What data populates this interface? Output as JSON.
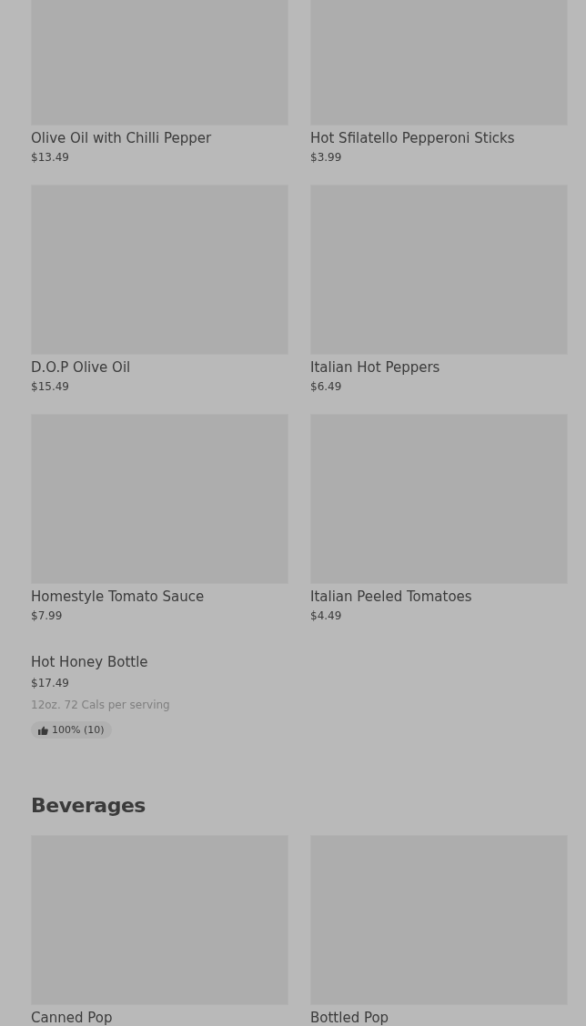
{
  "sections": [
    {
      "items": [
        {
          "kind": "image",
          "name": "Olive Oil with Chilli Pepper",
          "price": "$13.49"
        },
        {
          "kind": "image",
          "name": "Hot Sfilatello Pepperoni Sticks",
          "price": "$3.99"
        },
        {
          "kind": "image",
          "name": "D.O.P Olive Oil",
          "price": "$15.49"
        },
        {
          "kind": "image",
          "name": "Italian Hot Peppers",
          "price": "$6.49"
        },
        {
          "kind": "image",
          "name": "Homestyle Tomato Sauce",
          "price": "$7.99"
        },
        {
          "kind": "image",
          "name": "Italian Peeled Tomatoes",
          "price": "$4.49"
        },
        {
          "kind": "plain",
          "name": "Hot Honey Bottle",
          "price": "$17.49",
          "details": "12oz. 72 Cals per serving",
          "rating": "100% (10)"
        }
      ]
    },
    {
      "heading": "Beverages",
      "items": [
        {
          "kind": "image",
          "name": "Canned Pop"
        },
        {
          "kind": "image",
          "name": "Bottled Pop"
        }
      ]
    }
  ]
}
